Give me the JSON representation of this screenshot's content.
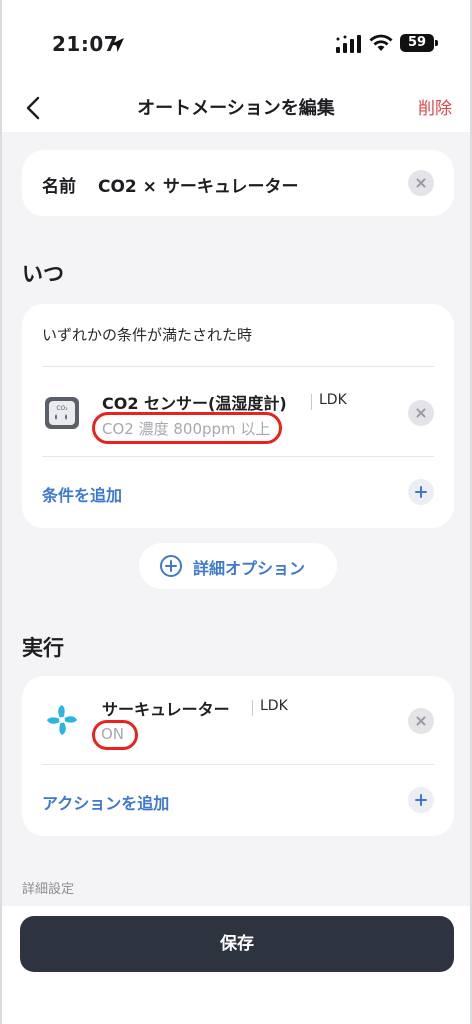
{
  "status_bar": {
    "time": "21:07",
    "battery": "59",
    "icons": [
      "location-arrow-icon",
      "signal-icon",
      "wifi-icon",
      "battery-icon"
    ]
  },
  "nav": {
    "back_icon": "chevron-left-icon",
    "title": "オートメーションを編集",
    "delete_label": "削除"
  },
  "name_card": {
    "label": "名前",
    "value": "CO2 × サーキュレーター"
  },
  "when": {
    "section_title": "いつ",
    "caption": "いずれかの条件が満たされた時",
    "condition": {
      "icon": "co2-sensor-icon",
      "title": "CO2 センサー(温湿度計)",
      "room": "LDK",
      "detail": "CO2 濃度 800ppm 以上"
    },
    "add_label": "条件を追加"
  },
  "options": {
    "label": "詳細オプション"
  },
  "execute": {
    "section_title": "実行",
    "action": {
      "icon": "circulator-fan-icon",
      "title": "サーキュレーター",
      "room": "LDK",
      "detail": "ON"
    },
    "add_label": "アクションを追加"
  },
  "detail_settings_label": "詳細設定",
  "save_label": "保存",
  "colors": {
    "accent": "#3f79cf",
    "delete": "#e0454a",
    "highlight": "#e8231b",
    "save_button": "#2e3340"
  }
}
